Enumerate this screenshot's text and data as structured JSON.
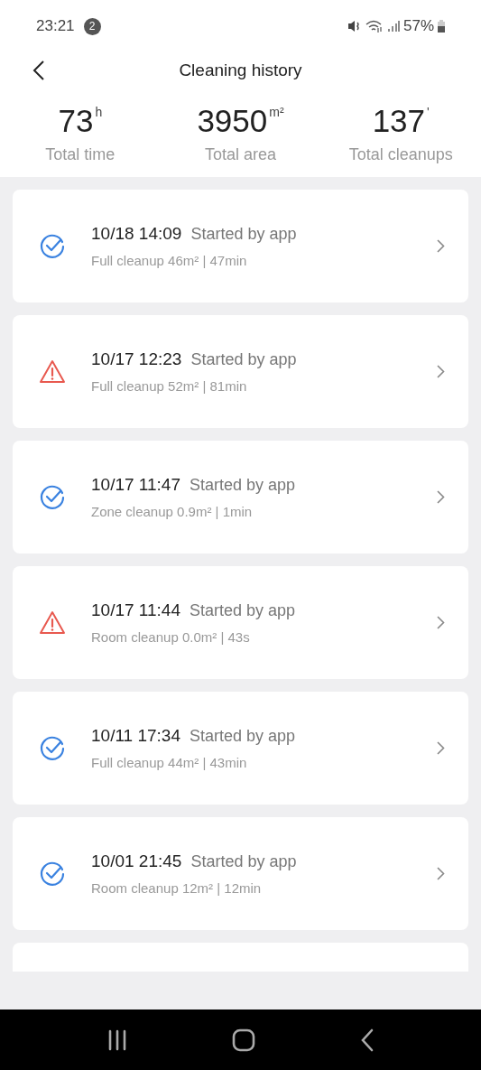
{
  "status_bar": {
    "time": "23:21",
    "notification_count": "2",
    "battery": "57%"
  },
  "header": {
    "title": "Cleaning history"
  },
  "stats": [
    {
      "value": "73",
      "unit": "h",
      "label": "Total time"
    },
    {
      "value": "3950",
      "unit": "m²",
      "label": "Total area"
    },
    {
      "value": "137",
      "unit": "'",
      "label": "Total cleanups"
    }
  ],
  "records": [
    {
      "kind": "success",
      "datetime": "10/18 14:09",
      "source": "Started by app",
      "details": "Full cleanup 46m² | 47min"
    },
    {
      "kind": "error",
      "datetime": "10/17 12:23",
      "source": "Started by app",
      "details": "Full cleanup 52m² | 81min"
    },
    {
      "kind": "success",
      "datetime": "10/17 11:47",
      "source": "Started by app",
      "details": "Zone cleanup 0.9m² | 1min"
    },
    {
      "kind": "error",
      "datetime": "10/17 11:44",
      "source": "Started by app",
      "details": "Room cleanup 0.0m² | 43s"
    },
    {
      "kind": "success",
      "datetime": "10/11 17:34",
      "source": "Started by app",
      "details": "Full cleanup 44m² | 43min"
    },
    {
      "kind": "success",
      "datetime": "10/01 21:45",
      "source": "Started by app",
      "details": "Room cleanup 12m² | 12min"
    }
  ]
}
